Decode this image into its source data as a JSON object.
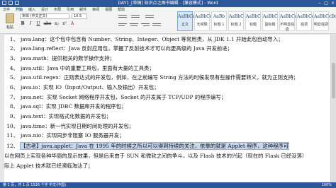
{
  "window": {
    "title": "DAY1_[草稿] 知识点之图书编辑 - [兼容模式] - Word",
    "controls": [
      "−",
      "□",
      "×"
    ]
  },
  "ribbon": {
    "tabs": [
      "文件",
      "开始",
      "插入",
      "设计",
      "布局",
      "引用",
      "邮件",
      "审阅",
      "视图",
      "帮助"
    ],
    "active_tab": "开始",
    "paste_label": "粘贴",
    "font_name": "宋体 (中文正文)",
    "font_size": "10.5",
    "format_buttons": [
      "B",
      "I",
      "U",
      "abc",
      "x₂",
      "x²",
      "A"
    ],
    "styles": [
      {
        "preview": "AaBbCcDd",
        "label": "正文"
      },
      {
        "preview": "AaBbCcDd",
        "label": "无间隔"
      },
      {
        "preview": "AaBb",
        "label": "标题 1"
      },
      {
        "preview": "AaBbC",
        "label": "标题 2"
      },
      {
        "preview": "AaBbC",
        "label": "标题"
      },
      {
        "preview": "AaBbC",
        "label": "副标题"
      },
      {
        "preview": "AaBbCcD",
        "label": "不明显强调"
      },
      {
        "preview": "AaBbCcD",
        "label": "强调"
      },
      {
        "preview": "AaBbCcDd",
        "label": "明显强调"
      }
    ]
  },
  "document": {
    "lines": [
      {
        "num": "1、",
        "text": "java.lang：这个包中包含有 Number、String、Integer、Object 等常用类，从 JDK 1.1 开始此包自动导入；"
      },
      {
        "num": "2、",
        "text": "java.lang.reflect：Java 反射应用包，掌握了反射技术才可以向更高级的 Java 开发前进；"
      },
      {
        "num": "3、",
        "text": "java.math：提供相关的数学操作支持；"
      },
      {
        "num": "4、",
        "text": "java.util：Java 中的重要工具包，里面有大量的工具类；"
      },
      {
        "num": "5、",
        "text": "java.util.regex：正则表达式的开发包，例如，在之前编写 String 方法的时候发现有些操作需要转义，就为正则支持；"
      },
      {
        "num": "6、",
        "text": "java.io：实现 IO（Input/Output、输入及输出）开发包；"
      },
      {
        "num": "7、",
        "text": "java.net：实现 Socket 网络程序开发包，Socket 的开发属于 TCP/UDP 的程序编写；"
      },
      {
        "num": "8、",
        "text": "java.sql：实现 JDBC 数据库开发的程序包；"
      },
      {
        "num": "9、",
        "text": "java.text：实现格式化数据的开发包；"
      },
      {
        "num": "10、",
        "text": "java.time：新一代实现日期时间处理的开发包；"
      },
      {
        "num": "11、",
        "text": "java.nio：实现同步非阻塞 IO 服务器开发；"
      },
      {
        "num": "12、",
        "text": "【古老】java.applet：Java 在 1995 年的时候之所以可以得到持续的关注，依靠的就是 Applet 程序，这种程序可"
      },
      {
        "num": "",
        "text": "以在网页上实现各种华丽的显示效果，但是后来由于 SUN 和微软之间的争斗，以及 Flash 技术的兴起（现在的 Flask 已经没落）"
      },
      {
        "num": "",
        "text": "际上 Applet 技术就已经濒临淘汰了；"
      }
    ]
  },
  "status": {
    "left": "第 1 页，共 1 页    1526 个字    中文(中国)",
    "right": "100%"
  }
}
